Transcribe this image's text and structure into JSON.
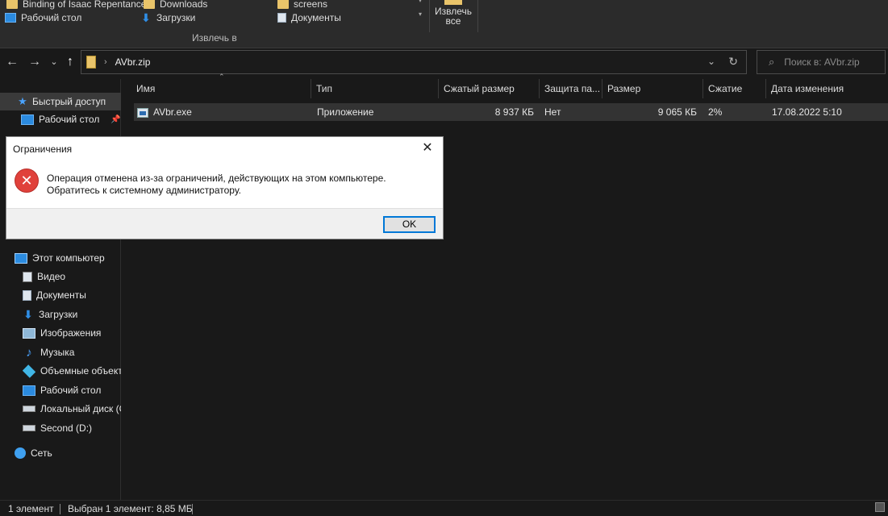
{
  "ribbon": {
    "quick_items": [
      {
        "label": "Binding of Isaac Repentance",
        "icon": "folder-icon"
      },
      {
        "label": "Downloads",
        "icon": "folder-icon"
      },
      {
        "label": "screens",
        "icon": "folder-icon"
      },
      {
        "label": "Рабочий стол",
        "icon": "desktop-icon"
      },
      {
        "label": "Загрузки",
        "icon": "download-arrow-icon"
      },
      {
        "label": "Документы",
        "icon": "documents-icon"
      }
    ],
    "extract_all_label": "Извлечь все",
    "group_label": "Извлечь в"
  },
  "nav": {
    "back": "←",
    "forward": "→",
    "recent": "⌄",
    "up": "↑",
    "path": "AVbr.zip",
    "search_placeholder": "Поиск в: AVbr.zip"
  },
  "sidebar": {
    "items": [
      {
        "label": "Быстрый доступ",
        "icon": "star-icon"
      },
      {
        "label": "Рабочий стол",
        "icon": "desktop-icon"
      },
      {
        "label": "Этот компьютер",
        "icon": "computer-icon"
      },
      {
        "label": "Видео",
        "icon": "video-icon"
      },
      {
        "label": "Документы",
        "icon": "documents-icon"
      },
      {
        "label": "Загрузки",
        "icon": "download-arrow-icon"
      },
      {
        "label": "Изображения",
        "icon": "images-icon"
      },
      {
        "label": "Музыка",
        "icon": "music-icon"
      },
      {
        "label": "Объемные объекты",
        "icon": "3d-objects-icon"
      },
      {
        "label": "Рабочий стол",
        "icon": "desktop-icon"
      },
      {
        "label": "Локальный диск (C:)",
        "icon": "disk-icon"
      },
      {
        "label": "Second (D:)",
        "icon": "disk-icon"
      },
      {
        "label": "Сеть",
        "icon": "network-icon"
      }
    ]
  },
  "columns": [
    "Имя",
    "Тип",
    "Сжатый размер",
    "Защита па...",
    "Размер",
    "Сжатие",
    "Дата изменения"
  ],
  "files": [
    {
      "name": "AVbr.exe",
      "type": "Приложение",
      "compressed": "8 937 КБ",
      "protected": "Нет",
      "size": "9 065 КБ",
      "ratio": "2%",
      "modified": "17.08.2022 5:10"
    }
  ],
  "dialog": {
    "title": "Ограничения",
    "message": "Операция отменена из-за ограничений, действующих на этом компьютере. Обратитесь к системному администратору.",
    "ok": "OK",
    "close": "✕"
  },
  "status": {
    "count": "1 элемент",
    "selected": "Выбран 1 элемент: 8,85 МБ"
  }
}
